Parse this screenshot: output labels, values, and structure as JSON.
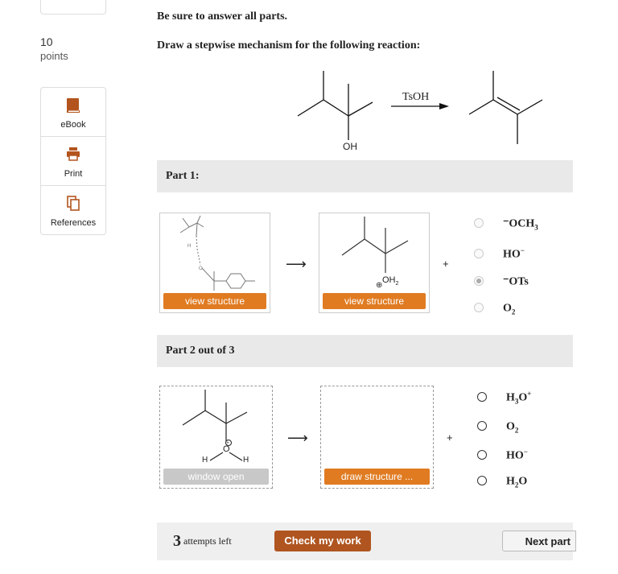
{
  "sidebar": {
    "points_value": "10",
    "points_label": "points",
    "tools": [
      {
        "label": "eBook",
        "icon": "book-icon"
      },
      {
        "label": "Print",
        "icon": "printer-icon"
      },
      {
        "label": "References",
        "icon": "copy-icon"
      }
    ]
  },
  "question": {
    "instruction1": "Be sure to answer all parts.",
    "instruction2": "Draw a stepwise mechanism for the following reaction:",
    "reagent": "TsOH",
    "oh_label": "OH"
  },
  "part1": {
    "header": "Part 1:",
    "box1_button": "view structure",
    "box2_button": "view structure",
    "oh2_label": "OH",
    "oh2_sub": "2",
    "options": [
      {
        "pre": "⁻OCH",
        "sub": "3",
        "sup": "",
        "checked": false
      },
      {
        "pre": "HO",
        "sub": "",
        "sup": "−",
        "checked": false
      },
      {
        "pre": "⁻OTs",
        "sub": "",
        "sup": "",
        "checked": true
      },
      {
        "pre": "O",
        "sub": "2",
        "sup": "",
        "checked": false
      }
    ]
  },
  "part2": {
    "header": "Part 2 out of 3",
    "box1_button": "window open",
    "box2_button": "draw structure ...",
    "o_label": "O",
    "h_label": "H",
    "options": [
      {
        "pre": "H",
        "sub": "3",
        "mid": "O",
        "sup": "+"
      },
      {
        "pre": "O",
        "sub": "2",
        "mid": "",
        "sup": ""
      },
      {
        "pre": "HO",
        "sub": "",
        "mid": "",
        "sup": "−"
      },
      {
        "pre": "H",
        "sub": "2",
        "mid": "O",
        "sup": ""
      }
    ]
  },
  "footer": {
    "attempts_count": "3",
    "attempts_label": "attempts left",
    "check_label": "Check my work",
    "next_label": "Next part"
  },
  "arrow_glyph": "⟶",
  "plus_glyph": "+",
  "colors": {
    "accent": "#e07b22",
    "check": "#b05520",
    "header_bg": "#e9e9e9"
  }
}
